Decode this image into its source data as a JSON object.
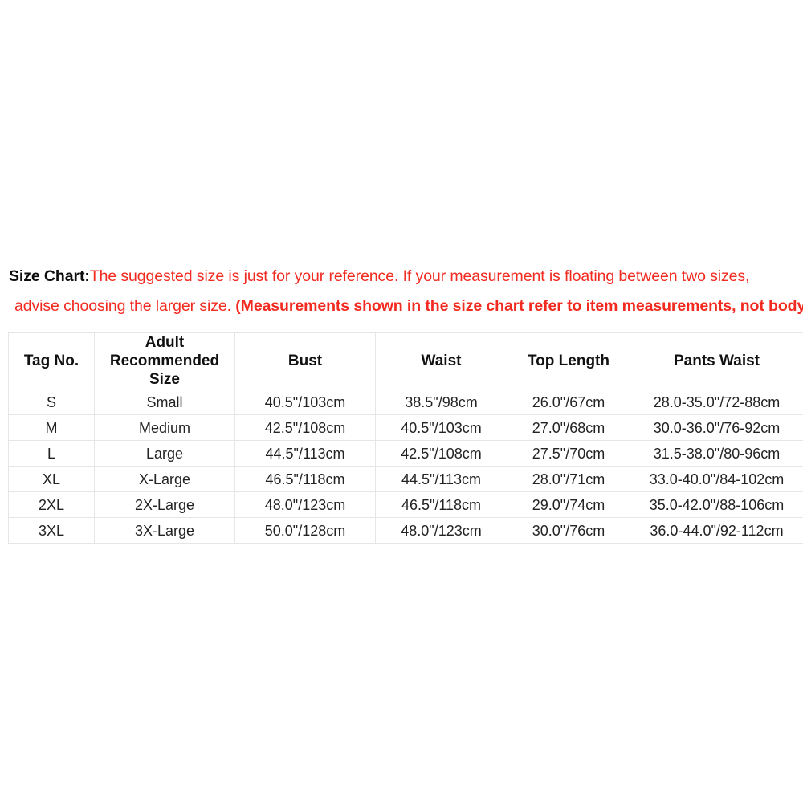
{
  "note": {
    "label": "Size Chart:",
    "line1_red": "The suggested size is just for your reference. If your measurement is floating between two sizes,",
    "line2_regular": "advise choosing the larger size. ",
    "line2_bold": "(Measurements shown in the size chart refer to item measurements, not body)",
    "label_color": "#0d0d0d",
    "red_color": "#f22a20"
  },
  "table": {
    "headers": [
      "Tag No.",
      "Adult Recommended Size",
      "Bust",
      "Waist",
      "Top Length",
      "Pants Waist"
    ],
    "rows": [
      {
        "tag": "S",
        "recommended": "Small",
        "bust": "40.5\"/103cm",
        "waist": "38.5\"/98cm",
        "top_length": "26.0\"/67cm",
        "pants_waist": "28.0-35.0\"/72-88cm"
      },
      {
        "tag": "M",
        "recommended": "Medium",
        "bust": "42.5\"/108cm",
        "waist": "40.5\"/103cm",
        "top_length": "27.0\"/68cm",
        "pants_waist": "30.0-36.0\"/76-92cm"
      },
      {
        "tag": "L",
        "recommended": "Large",
        "bust": "44.5\"/113cm",
        "waist": "42.5\"/108cm",
        "top_length": "27.5\"/70cm",
        "pants_waist": "31.5-38.0\"/80-96cm"
      },
      {
        "tag": "XL",
        "recommended": "X-Large",
        "bust": "46.5\"/118cm",
        "waist": "44.5\"/113cm",
        "top_length": "28.0\"/71cm",
        "pants_waist": "33.0-40.0\"/84-102cm"
      },
      {
        "tag": "2XL",
        "recommended": "2X-Large",
        "bust": "48.0\"/123cm",
        "waist": "46.5\"/118cm",
        "top_length": "29.0\"/74cm",
        "pants_waist": "35.0-42.0\"/88-106cm"
      },
      {
        "tag": "3XL",
        "recommended": "3X-Large",
        "bust": "50.0\"/128cm",
        "waist": "48.0\"/123cm",
        "top_length": "30.0\"/76cm",
        "pants_waist": "36.0-44.0\"/92-112cm"
      }
    ],
    "border_color": "#e6e6e6"
  }
}
